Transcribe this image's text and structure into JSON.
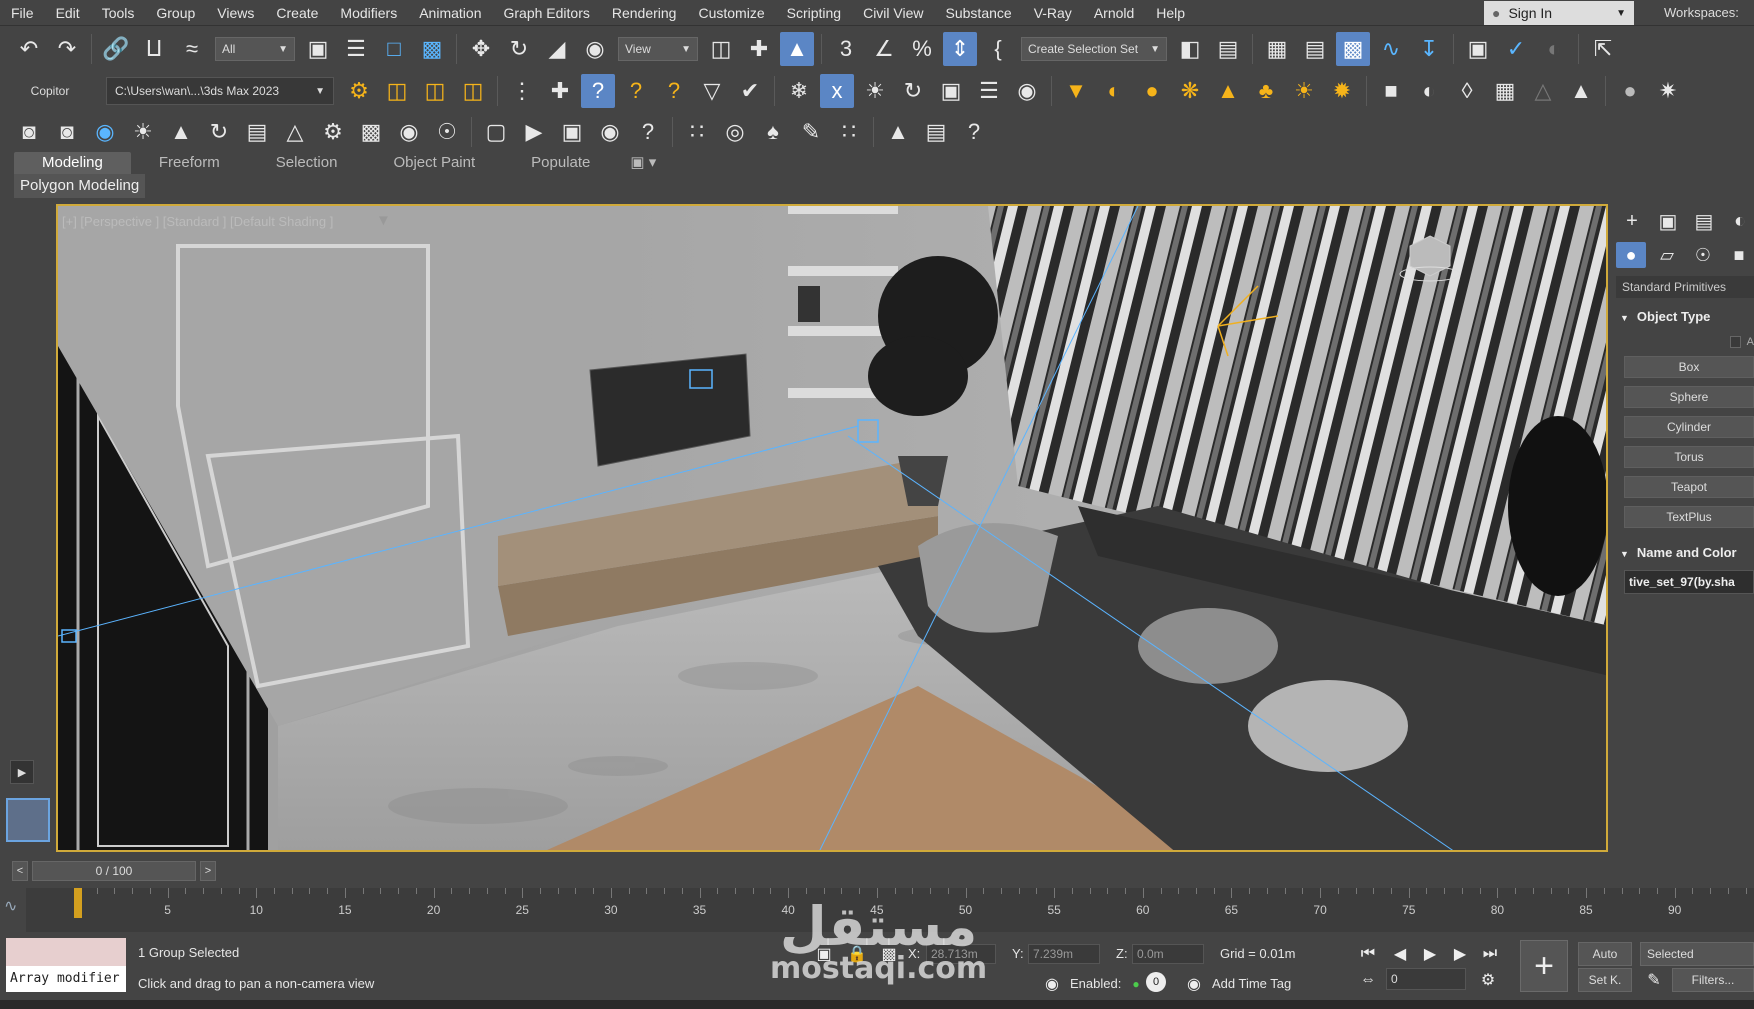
{
  "menu": {
    "items": [
      "File",
      "Edit",
      "Tools",
      "Group",
      "Views",
      "Create",
      "Modifiers",
      "Animation",
      "Graph Editors",
      "Rendering",
      "Customize",
      "Scripting",
      "Civil View",
      "Substance",
      "V-Ray",
      "Arnold",
      "Help"
    ],
    "sign_in": "Sign In",
    "workspaces": "Workspaces:"
  },
  "toolbar1": {
    "filter_select": "All",
    "ref_coord_select": "View",
    "selection_set_select": "Create Selection Set",
    "icons": [
      "undo-icon",
      "redo-icon",
      "link-icon",
      "unlink-icon",
      "bind-space-warp-icon",
      "select-object-icon",
      "select-by-name-icon",
      "rect-selection-icon",
      "window-crossing-icon",
      "move-icon",
      "rotate-icon",
      "scale-icon",
      "placement-icon",
      "pivot-center-icon",
      "select-manipulate-icon",
      "keyboard-shortcut-icon",
      "snaps-3d-icon",
      "angle-snap-icon",
      "percent-snap-icon",
      "spinner-snap-icon",
      "edit-named-sets-icon",
      "mirror-icon",
      "align-icon",
      "scene-explorer-icon",
      "layer-explorer-icon",
      "ribbon-toggle-icon",
      "curve-editor-icon",
      "schematic-view-icon",
      "material-editor-icon",
      "render-setup-icon",
      "rendered-frame-window-icon",
      "render-production-icon"
    ]
  },
  "toolbar2": {
    "label": "Copitor",
    "project_path": "C:\\Users\\wan\\...\\3ds Max 2023"
  },
  "ribbon": {
    "tabs": [
      "Modeling",
      "Freeform",
      "Selection",
      "Object Paint",
      "Populate"
    ],
    "active_tab": "Modeling",
    "panel": "Polygon Modeling"
  },
  "viewport": {
    "label": "[+] [Perspective ] [Standard ] [Default Shading ]"
  },
  "command_panel": {
    "category": "Standard Primitives",
    "object_type_title": "Object Type",
    "autogrid_label": "A",
    "buttons": [
      "Box",
      "Sphere",
      "Cylinder",
      "Torus",
      "Teapot",
      "TextPlus"
    ],
    "name_color_title": "Name and Color",
    "object_name": "tive_set_97(by.sha"
  },
  "time_slider": {
    "frame_display": "0 / 100",
    "prev": "<",
    "next": ">"
  },
  "track_bar": {
    "tick_labels": [
      "0",
      "5",
      "10",
      "15",
      "20",
      "25",
      "30",
      "35",
      "40",
      "45",
      "50",
      "55",
      "60",
      "65",
      "70",
      "75",
      "80",
      "85",
      "90"
    ]
  },
  "status": {
    "modifier_text": "Array modifier",
    "selection_count": "1 Group Selected",
    "prompt": "Click and drag to pan a non-camera view",
    "x_label": "X:",
    "x_value": "28.713m",
    "y_label": "Y:",
    "y_value": "7.239m",
    "z_label": "Z:",
    "z_value": "0.0m",
    "grid": "Grid = 0.01m",
    "enabled_label": "Enabled:",
    "add_time_tag": "Add Time Tag",
    "auto_key": "Auto",
    "set_key": "Set K.",
    "key_filter": "Selected",
    "filters": "Filters...",
    "current_frame": "0"
  },
  "watermark": {
    "arabic": "مستقل",
    "latin": "mostaqi.com"
  },
  "colors": {
    "accent_blue": "#5b86c5",
    "viewport_border": "#d0aa3a",
    "icon_yellow": "#f6b41a"
  }
}
